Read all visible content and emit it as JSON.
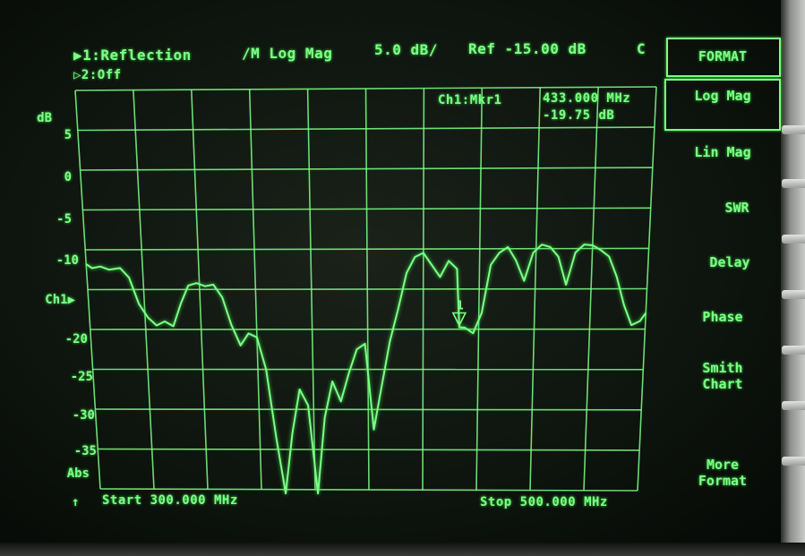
{
  "header": {
    "channel1": "▶1:Reflection",
    "channel2": "▷2:Off",
    "format": "/M Log Mag",
    "scale": "5.0 dB/",
    "ref": "Ref -15.00 dB",
    "flag": "C"
  },
  "marker": {
    "label": "Ch1:Mkr1",
    "frequency": "433.000 MHz",
    "value": "-19.75 dB",
    "number": "1"
  },
  "y_axis": {
    "unit": "dB",
    "ticks": [
      "5",
      "0",
      "-5",
      "-10",
      "-20",
      "-25",
      "-30",
      "-35"
    ],
    "ch1_indicator": "Ch1",
    "abs_label": "Abs"
  },
  "footer": {
    "arrow": "↑",
    "start": "Start 300.000 MHz",
    "stop": "Stop 500.000 MHz"
  },
  "softkeys": {
    "title": "FORMAT",
    "items": [
      "Log Mag",
      "Lin Mag",
      "SWR",
      "Delay",
      "Phase",
      "Smith\nChart",
      "More\nFormat"
    ]
  },
  "colors": {
    "trace": "#7dff86",
    "background": "#0c110c"
  },
  "chart_data": {
    "type": "line",
    "xlabel": "",
    "ylabel": "dB",
    "xlim": [
      300,
      500
    ],
    "ylim": [
      -40,
      10
    ],
    "series": [
      {
        "x": [
          300,
          302,
          305,
          308,
          312,
          315,
          318,
          321,
          324,
          327,
          330,
          333,
          336,
          339,
          342,
          345,
          348,
          351,
          354,
          357,
          360,
          363,
          366,
          369,
          372,
          375,
          378,
          381,
          384,
          387,
          390,
          393,
          396,
          399,
          402,
          405,
          408,
          411,
          414,
          417,
          420,
          423,
          426,
          429,
          432,
          433,
          435,
          438,
          441,
          444,
          447,
          450,
          453,
          456,
          459,
          462,
          465,
          468,
          471,
          474,
          477,
          480,
          483,
          486,
          489,
          492,
          495,
          498,
          500
        ],
        "y": [
          -11.8,
          -12.3,
          -12.1,
          -12.5,
          -12.3,
          -13.5,
          -16.8,
          -18.5,
          -19.5,
          -19,
          -19.6,
          -16.8,
          -14.5,
          -14.2,
          -14.6,
          -14.4,
          -16,
          -19.5,
          -22,
          -20.5,
          -21,
          -25,
          -33.5,
          -40.5,
          -33,
          -27.5,
          -29.5,
          -40.5,
          -31,
          -26.5,
          -29,
          -25.5,
          -22.5,
          -21.8,
          -32.5,
          -27,
          -21.5,
          -17.5,
          -13,
          -11,
          -10.5,
          -12,
          -13.5,
          -11.5,
          -12.5,
          -19.75,
          -19.8,
          -20.5,
          -18,
          -12,
          -10.5,
          -9.8,
          -11.5,
          -14,
          -10.5,
          -9.5,
          -9.8,
          -11,
          -14.5,
          -10.5,
          -9.5,
          -9.6,
          -10.2,
          -11,
          -13.5,
          -17,
          -19.5,
          -19,
          -18
        ]
      }
    ],
    "markers": [
      {
        "name": "1",
        "x": 433.0,
        "y": -19.75
      }
    ]
  }
}
